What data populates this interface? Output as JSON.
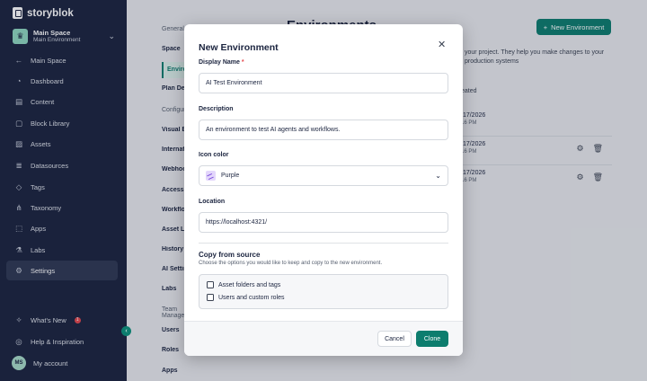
{
  "app": {
    "brand": "storyblok"
  },
  "space": {
    "name": "Main Space",
    "environment": "Main Environment"
  },
  "sidebar": {
    "items": [
      {
        "label": "Main Space",
        "icon": "arrow-left-icon"
      },
      {
        "label": "Dashboard",
        "icon": "dashboard-icon"
      },
      {
        "label": "Content",
        "icon": "content-icon"
      },
      {
        "label": "Block Library",
        "icon": "blocks-icon"
      },
      {
        "label": "Assets",
        "icon": "image-icon"
      },
      {
        "label": "Datasources",
        "icon": "database-icon"
      },
      {
        "label": "Tags",
        "icon": "tag-icon"
      },
      {
        "label": "Taxonomy",
        "icon": "taxonomy-icon"
      },
      {
        "label": "Apps",
        "icon": "apps-icon"
      },
      {
        "label": "Labs",
        "icon": "flask-icon"
      },
      {
        "label": "Settings",
        "icon": "gear-icon"
      }
    ],
    "bottom": [
      {
        "label": "What's New",
        "icon": "sparkle-icon",
        "badge": "1"
      },
      {
        "label": "Help & Inspiration",
        "icon": "help-icon"
      },
      {
        "label": "My account",
        "avatar": "MS"
      }
    ]
  },
  "subnav": {
    "general_header": "General",
    "general_items": [
      "Space",
      "Environments",
      "Plan Details"
    ],
    "config_header": "Configuration",
    "config_items": [
      "Visual Editor",
      "Internationalization",
      "Webhooks",
      "Access Tokens",
      "Workflows",
      "Asset Library",
      "History",
      "AI Settings",
      "Labs"
    ],
    "team_header": "Team Management",
    "team_items": [
      "Users",
      "Roles"
    ],
    "apps_header": "Apps"
  },
  "main": {
    "title": "Environments",
    "new_env_label": "New Environment",
    "description": "your project. They help you make changes to your production systems",
    "col_created": "eated",
    "rows": [
      {
        "date": "/17/2026",
        "time": "16 PM"
      },
      {
        "date": "/17/2026",
        "time": "16 PM"
      },
      {
        "date": "/17/2026",
        "time": "16 PM"
      }
    ]
  },
  "modal": {
    "title": "New Environment",
    "display_name_label": "Display Name",
    "required_marker": "*",
    "display_name_value": "AI Test Environment",
    "description_label": "Description",
    "description_value": "An environment to test AI agents and workflows.",
    "icon_color_label": "Icon color",
    "icon_color_value": "Purple",
    "icon_color_swatch": "#e3d6fb",
    "location_label": "Location",
    "location_value": "https://localhost:4321/",
    "copy_title": "Copy from source",
    "copy_subtitle": "Choose the options you would like to keep and copy to the new environment.",
    "options": [
      "Asset folders and tags",
      "Users and custom roles"
    ],
    "cancel_label": "Cancel",
    "clone_label": "Clone"
  },
  "colors": {
    "sidebar": "#1b243f",
    "accent": "#0d7d6e"
  }
}
